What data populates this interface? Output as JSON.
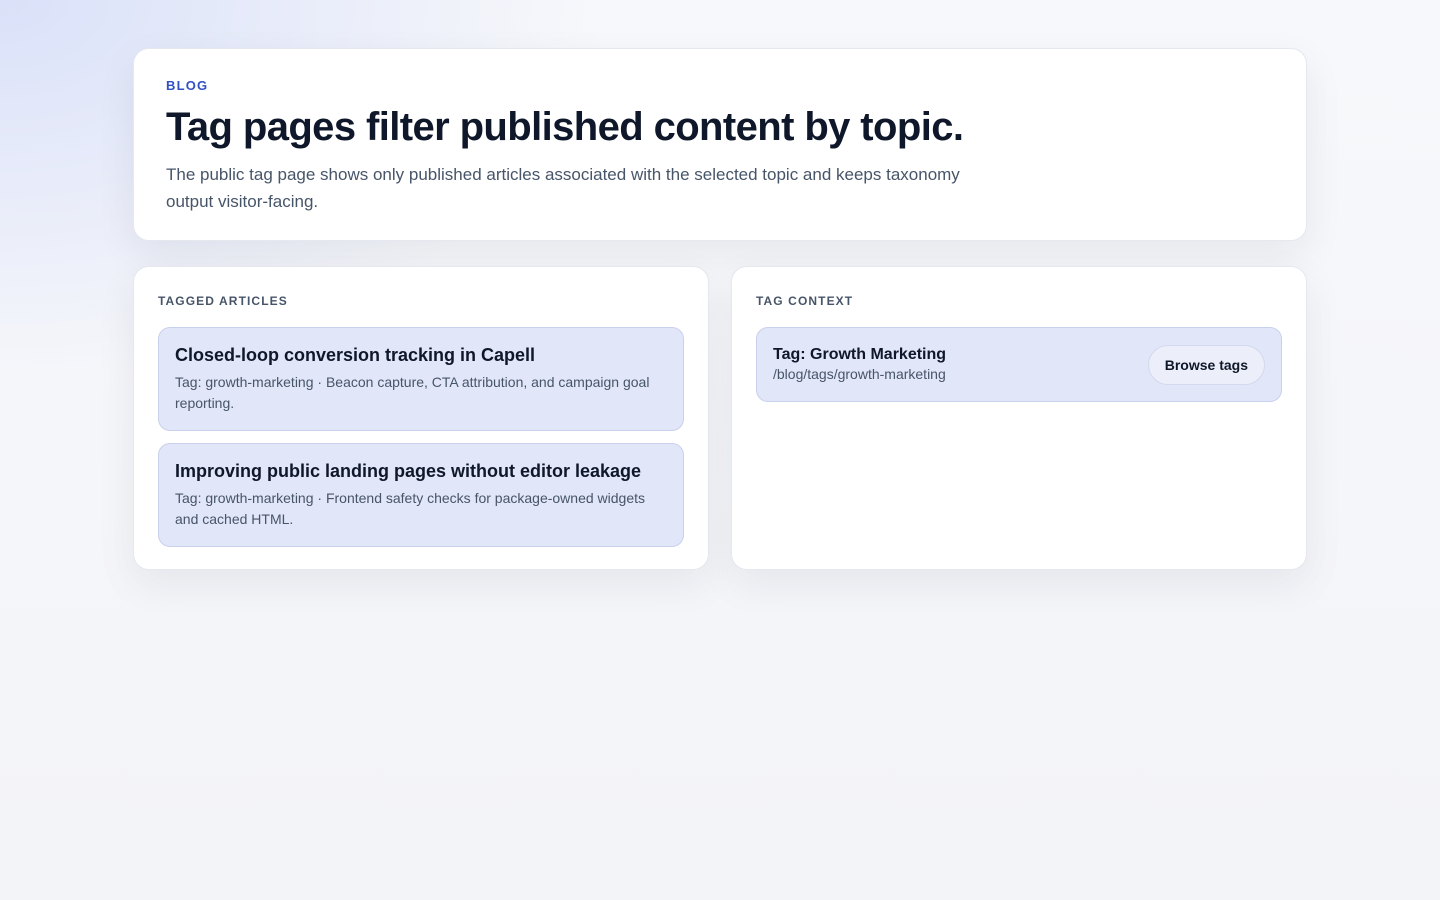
{
  "hero": {
    "eyebrow": "BLOG",
    "title": "Tag pages filter published content by topic.",
    "description": "The public tag page shows only published articles associated with the selected topic and keeps taxonomy output visitor-facing."
  },
  "tagged_articles": {
    "label": "TAGGED ARTICLES",
    "items": [
      {
        "title": "Closed-loop conversion tracking in Capell",
        "meta": "Tag: growth-marketing · Beacon capture, CTA attribution, and campaign goal reporting."
      },
      {
        "title": "Improving public landing pages without editor leakage",
        "meta": "Tag: growth-marketing · Frontend safety checks for package-owned widgets and cached HTML."
      }
    ]
  },
  "tag_context": {
    "label": "TAG CONTEXT",
    "tag_name": "Tag: Growth Marketing",
    "tag_path": "/blog/tags/growth-marketing",
    "browse_label": "Browse tags"
  },
  "colors": {
    "accent": "#3150c4",
    "card_bg": "#e1e6f8",
    "text": "#0f172a",
    "muted": "#475569"
  }
}
